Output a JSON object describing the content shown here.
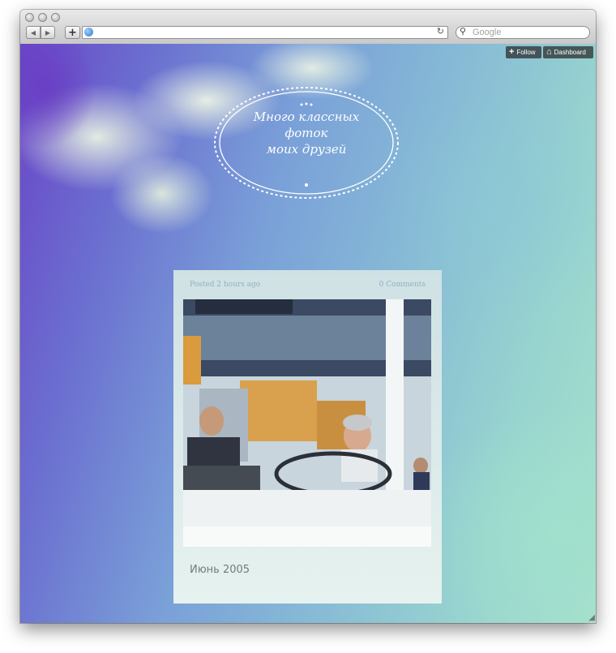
{
  "browser": {
    "search": {
      "placeholder": "Google"
    },
    "address": {
      "value": ""
    }
  },
  "toolbar": {
    "follow_label": "Follow",
    "dashboard_label": "Dashboard"
  },
  "blog": {
    "title_lines": [
      "Много классных",
      "фоток",
      "моих друзей"
    ]
  },
  "post": {
    "posted": "Posted 2 hours ago",
    "comments": "0 Comments",
    "caption": "Июнь 2005"
  }
}
